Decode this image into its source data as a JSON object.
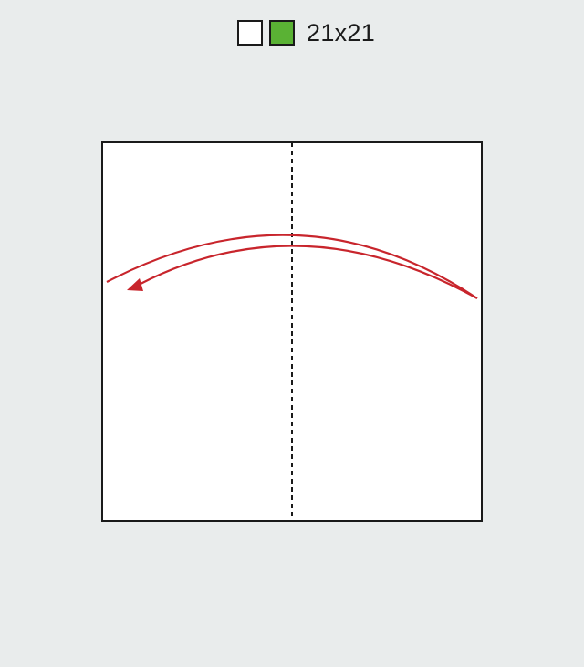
{
  "legend": {
    "front_color": "#ffffff",
    "back_color": "#5ab234",
    "size_label": "21x21"
  },
  "diagram": {
    "paper_color": "#ffffff",
    "edge_color": "#1a1a1a",
    "fold_line": "valley-fold-dashed-vertical",
    "arrow_color": "#c8252c",
    "arrow_direction": "right-to-left"
  }
}
